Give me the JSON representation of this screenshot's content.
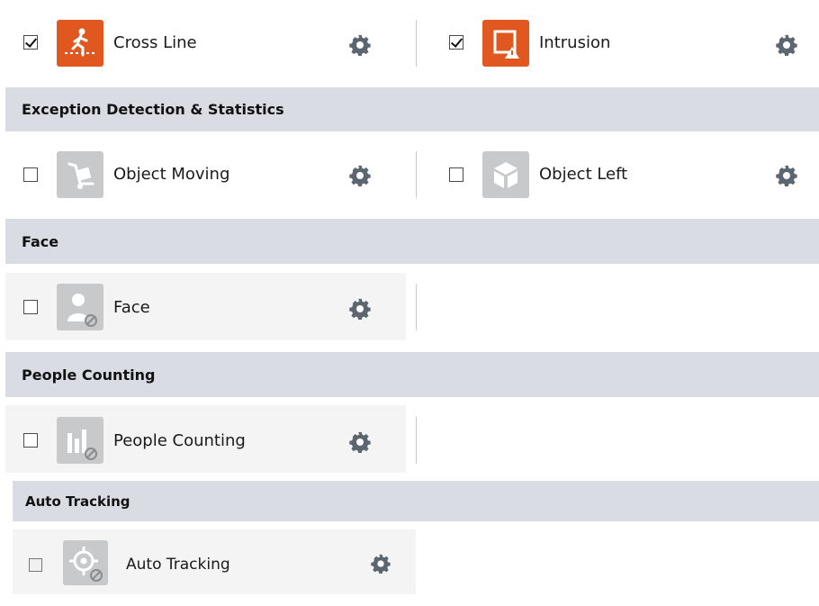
{
  "rows": {
    "cross_line": {
      "label": "Cross Line",
      "checked": true,
      "icon": "person-crossing-line-icon"
    },
    "intrusion": {
      "label": "Intrusion",
      "checked": true,
      "icon": "intrusion-region-icon"
    },
    "object_moving": {
      "label": "Object Moving",
      "checked": false,
      "icon": "hand-truck-icon"
    },
    "object_left": {
      "label": "Object Left",
      "checked": false,
      "icon": "box-icon"
    },
    "face": {
      "label": "Face",
      "checked": false,
      "icon": "face-person-disabled-icon"
    },
    "people_counting": {
      "label": "People Counting",
      "checked": false,
      "icon": "bar-chart-disabled-icon"
    },
    "auto_tracking": {
      "label": "Auto Tracking",
      "checked": false,
      "icon": "crosshair-disabled-icon"
    }
  },
  "sections": {
    "exception": "Exception Detection & Statistics",
    "face": "Face",
    "people_counting": "People Counting",
    "auto_tracking": "Auto Tracking"
  },
  "colors": {
    "active_icon": "#e0571f",
    "inactive_icon": "#c7c9cb",
    "header_bg": "#d9dde3",
    "gear": "#5b6670"
  }
}
